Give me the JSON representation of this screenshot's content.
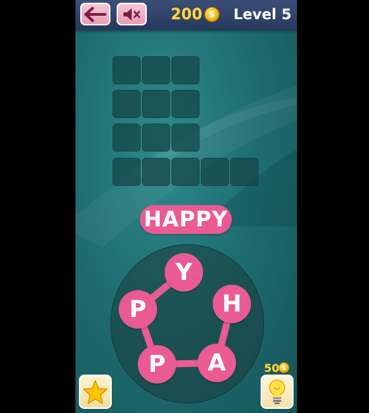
{
  "header": {
    "coins": "200",
    "coin_symbol": "$",
    "level_label": "Level 5"
  },
  "icons": {
    "back": "back-arrow-icon",
    "mute": "speaker-muted-icon",
    "star": "star-icon",
    "hint": "lightbulb-icon"
  },
  "puzzle": {
    "grid_rows": [
      3,
      3,
      3,
      5
    ],
    "current_word": "HAPPY"
  },
  "wheel": {
    "letters": [
      "Y",
      "H",
      "A",
      "P",
      "P"
    ],
    "selected_sequence": [
      "H",
      "A",
      "P",
      "P",
      "Y"
    ]
  },
  "hint": {
    "cost": "50",
    "coin_symbol": "$"
  },
  "colors": {
    "accent_pink": "#ea5b93",
    "background_teal": "#1f6f73",
    "topbar_navy": "#2f4068",
    "coin_gold": "#ffd64a"
  }
}
